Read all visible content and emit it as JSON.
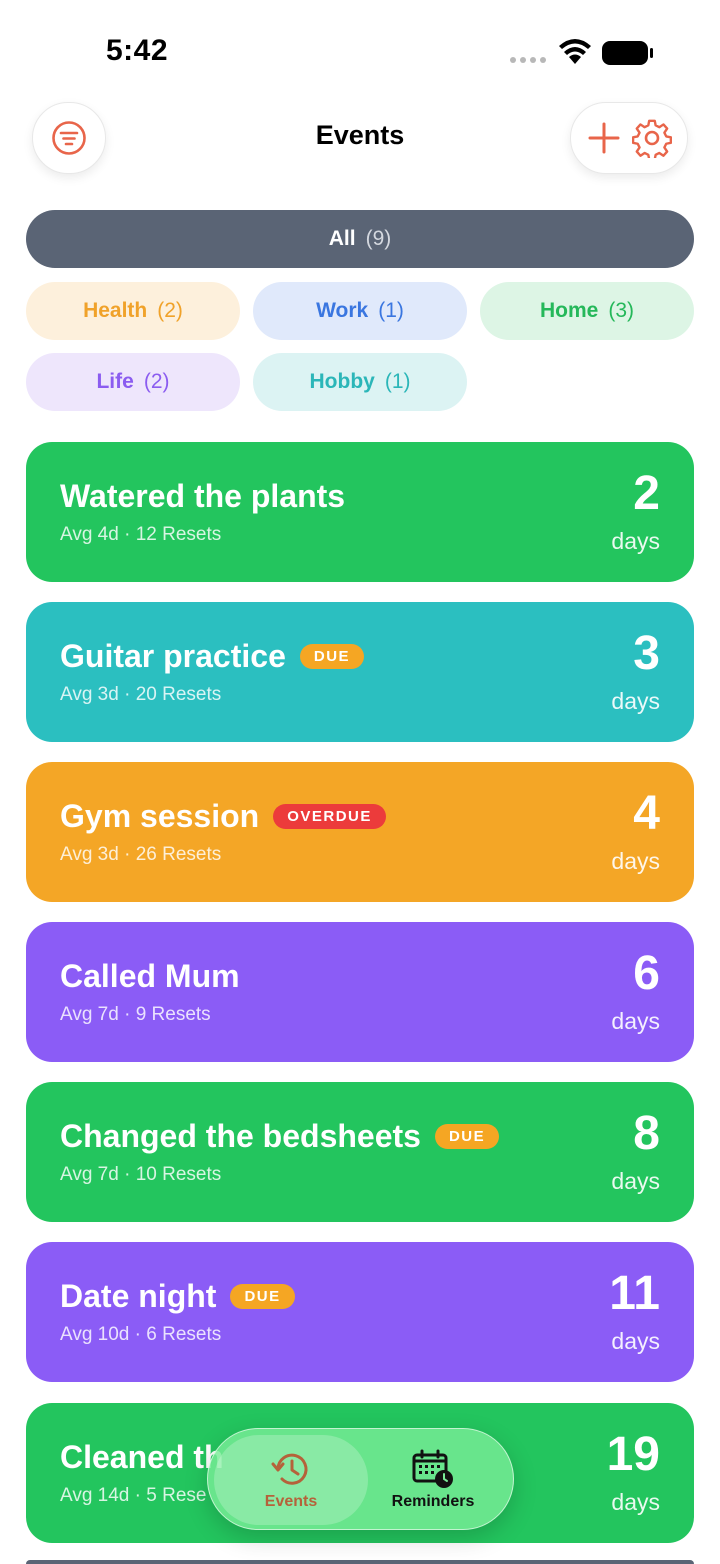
{
  "status_bar": {
    "time": "5:42"
  },
  "header": {
    "title": "Events"
  },
  "categories": [
    {
      "label": "All",
      "count": "(9)"
    },
    {
      "label": "Health",
      "count": "(2)"
    },
    {
      "label": "Work",
      "count": "(1)"
    },
    {
      "label": "Home",
      "count": "(3)"
    },
    {
      "label": "Life",
      "count": "(2)"
    },
    {
      "label": "Hobby",
      "count": "(1)"
    }
  ],
  "events": [
    {
      "title": "Watered the plants",
      "badge": "",
      "meta": "Avg 4d · 12 Resets",
      "days": "2",
      "unit": "days",
      "color": "#23c55e"
    },
    {
      "title": "Guitar practice",
      "badge": "DUE",
      "meta": "Avg 3d · 20 Resets",
      "days": "3",
      "unit": "days",
      "color": "#2bbfc0"
    },
    {
      "title": "Gym session",
      "badge": "OVERDUE",
      "meta": "Avg 3d · 26 Resets",
      "days": "4",
      "unit": "days",
      "color": "#f4a626"
    },
    {
      "title": "Called Mum",
      "badge": "",
      "meta": "Avg 7d · 9 Resets",
      "days": "6",
      "unit": "days",
      "color": "#8b5cf6"
    },
    {
      "title": "Changed the bedsheets",
      "badge": "DUE",
      "meta": "Avg 7d · 10 Resets",
      "days": "8",
      "unit": "days",
      "color": "#23c55e"
    },
    {
      "title": "Date night",
      "badge": "DUE",
      "meta": "Avg 10d · 6 Resets",
      "days": "11",
      "unit": "days",
      "color": "#8b5cf6"
    },
    {
      "title": "Cleaned th",
      "badge": "",
      "meta": "Avg 14d · 5 Rese",
      "days": "19",
      "unit": "days",
      "color": "#23c55e"
    }
  ],
  "tab_bar": {
    "events_label": "Events",
    "reminders_label": "Reminders"
  },
  "colors": {
    "accent": "#e8654a",
    "green": "#23c55e",
    "teal": "#2bbfc0",
    "orange": "#f4a626",
    "purple": "#8b5cf6",
    "overdue": "#ec3b3b"
  }
}
